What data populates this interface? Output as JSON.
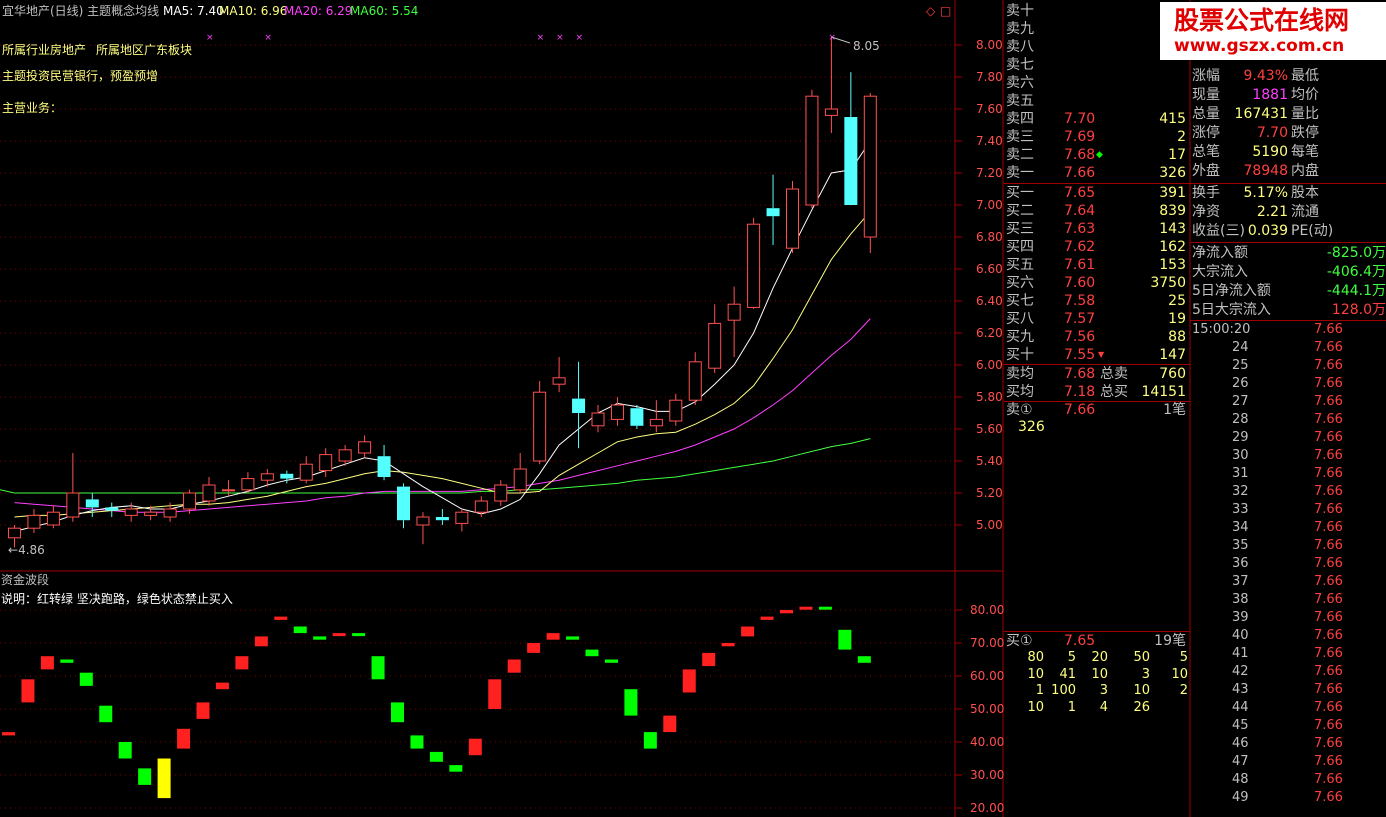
{
  "header": {
    "title": "宜华地产(日线) 主题概念均线",
    "ma5": "MA5: 7.40",
    "ma10": "MA10: 6.96",
    "ma20": "MA20: 6.29",
    "ma60": "MA60: 5.54"
  },
  "info": {
    "line1a": "所属行业房地产",
    "line1b": "所属地区广东板块",
    "line2": "主题投资民营银行，预盈预增",
    "line3": "主营业务："
  },
  "price_axis": [
    "8.00",
    "7.80",
    "7.60",
    "7.40",
    "7.20",
    "7.00",
    "6.80",
    "6.60",
    "6.40",
    "6.20",
    "6.00",
    "5.80",
    "5.60",
    "5.40",
    "5.20",
    "5.00"
  ],
  "price_labels": {
    "high": "8.05",
    "low": "4.86"
  },
  "indicator": {
    "name": "资金波段",
    "desc": "说明：红转绿 坚决跑路，绿色状态禁止买入",
    "axis": [
      "80.00",
      "70.00",
      "60.00",
      "50.00",
      "40.00",
      "30.00",
      "20.00"
    ]
  },
  "chart_data": {
    "type": "candlestick",
    "candles": [
      {
        "o": 4.92,
        "c": 4.98,
        "h": 5.0,
        "l": 4.86
      },
      {
        "o": 4.98,
        "c": 5.06,
        "h": 5.1,
        "l": 4.95
      },
      {
        "o": 5.0,
        "c": 5.08,
        "h": 5.12,
        "l": 4.98
      },
      {
        "o": 5.05,
        "c": 5.2,
        "h": 5.45,
        "l": 5.02
      },
      {
        "o": 5.16,
        "c": 5.11,
        "h": 5.2,
        "l": 5.05
      },
      {
        "o": 5.11,
        "c": 5.09,
        "h": 5.14,
        "l": 5.05
      },
      {
        "o": 5.06,
        "c": 5.1,
        "h": 5.14,
        "l": 5.02
      },
      {
        "o": 5.06,
        "c": 5.08,
        "h": 5.12,
        "l": 5.03
      },
      {
        "o": 5.05,
        "c": 5.1,
        "h": 5.14,
        "l": 5.02
      },
      {
        "o": 5.1,
        "c": 5.2,
        "h": 5.22,
        "l": 5.07
      },
      {
        "o": 5.15,
        "c": 5.25,
        "h": 5.3,
        "l": 5.12
      },
      {
        "o": 5.22,
        "c": 5.22,
        "h": 5.28,
        "l": 5.18
      },
      {
        "o": 5.22,
        "c": 5.29,
        "h": 5.33,
        "l": 5.2
      },
      {
        "o": 5.28,
        "c": 5.32,
        "h": 5.35,
        "l": 5.24
      },
      {
        "o": 5.32,
        "c": 5.29,
        "h": 5.34,
        "l": 5.26
      },
      {
        "o": 5.28,
        "c": 5.38,
        "h": 5.43,
        "l": 5.26
      },
      {
        "o": 5.34,
        "c": 5.44,
        "h": 5.48,
        "l": 5.3
      },
      {
        "o": 5.4,
        "c": 5.47,
        "h": 5.5,
        "l": 5.37
      },
      {
        "o": 5.45,
        "c": 5.52,
        "h": 5.56,
        "l": 5.42
      },
      {
        "o": 5.43,
        "c": 5.3,
        "h": 5.5,
        "l": 5.28
      },
      {
        "o": 5.24,
        "c": 5.03,
        "h": 5.26,
        "l": 4.98
      },
      {
        "o": 5.0,
        "c": 5.05,
        "h": 5.08,
        "l": 4.88
      },
      {
        "o": 5.05,
        "c": 5.03,
        "h": 5.1,
        "l": 5.0
      },
      {
        "o": 5.01,
        "c": 5.08,
        "h": 5.1,
        "l": 4.96
      },
      {
        "o": 5.08,
        "c": 5.15,
        "h": 5.18,
        "l": 5.05
      },
      {
        "o": 5.15,
        "c": 5.25,
        "h": 5.28,
        "l": 5.12
      },
      {
        "o": 5.22,
        "c": 5.35,
        "h": 5.45,
        "l": 5.2
      },
      {
        "o": 5.4,
        "c": 5.83,
        "h": 5.9,
        "l": 5.38
      },
      {
        "o": 5.88,
        "c": 5.92,
        "h": 6.05,
        "l": 5.83
      },
      {
        "o": 5.79,
        "c": 5.7,
        "h": 6.02,
        "l": 5.48
      },
      {
        "o": 5.62,
        "c": 5.7,
        "h": 5.75,
        "l": 5.58
      },
      {
        "o": 5.66,
        "c": 5.75,
        "h": 5.8,
        "l": 5.62
      },
      {
        "o": 5.73,
        "c": 5.62,
        "h": 5.75,
        "l": 5.6
      },
      {
        "o": 5.62,
        "c": 5.66,
        "h": 5.78,
        "l": 5.58
      },
      {
        "o": 5.65,
        "c": 5.78,
        "h": 5.82,
        "l": 5.62
      },
      {
        "o": 5.78,
        "c": 6.02,
        "h": 6.08,
        "l": 5.75
      },
      {
        "o": 5.98,
        "c": 6.26,
        "h": 6.38,
        "l": 5.95
      },
      {
        "o": 6.28,
        "c": 6.38,
        "h": 6.49,
        "l": 6.05
      },
      {
        "o": 6.36,
        "c": 6.88,
        "h": 6.92,
        "l": 6.35
      },
      {
        "o": 6.98,
        "c": 6.93,
        "h": 7.19,
        "l": 6.75
      },
      {
        "o": 6.73,
        "c": 7.1,
        "h": 7.15,
        "l": 6.7
      },
      {
        "o": 7.0,
        "c": 7.68,
        "h": 7.72,
        "l": 6.98
      },
      {
        "o": 7.56,
        "c": 7.6,
        "h": 8.05,
        "l": 7.45
      },
      {
        "o": 7.55,
        "c": 7.0,
        "h": 7.83,
        "l": 7.0
      },
      {
        "o": 6.8,
        "c": 7.68,
        "h": 7.7,
        "l": 6.7
      }
    ],
    "ma5": [
      4.96,
      4.99,
      5.02,
      5.06,
      5.09,
      5.11,
      5.12,
      5.1,
      5.1,
      5.13,
      5.15,
      5.18,
      5.21,
      5.25,
      5.28,
      5.3,
      5.34,
      5.38,
      5.42,
      5.4,
      5.32,
      5.24,
      5.17,
      5.1,
      5.07,
      5.1,
      5.16,
      5.32,
      5.5,
      5.6,
      5.7,
      5.76,
      5.74,
      5.71,
      5.71,
      5.77,
      5.88,
      6.0,
      6.2,
      6.48,
      6.73,
      6.97,
      7.2,
      7.22,
      7.4
    ],
    "ma10": [
      5.05,
      5.06,
      5.06,
      5.07,
      5.08,
      5.09,
      5.1,
      5.11,
      5.12,
      5.13,
      5.13,
      5.14,
      5.16,
      5.18,
      5.21,
      5.24,
      5.26,
      5.29,
      5.32,
      5.34,
      5.33,
      5.31,
      5.29,
      5.26,
      5.23,
      5.2,
      5.2,
      5.21,
      5.31,
      5.38,
      5.45,
      5.52,
      5.55,
      5.57,
      5.58,
      5.63,
      5.69,
      5.76,
      5.87,
      6.04,
      6.22,
      6.44,
      6.66,
      6.82,
      6.96
    ],
    "ma20": [
      5.14,
      5.13,
      5.12,
      5.11,
      5.1,
      5.09,
      5.08,
      5.08,
      5.08,
      5.09,
      5.1,
      5.11,
      5.12,
      5.13,
      5.14,
      5.15,
      5.17,
      5.18,
      5.2,
      5.21,
      5.21,
      5.21,
      5.21,
      5.21,
      5.22,
      5.23,
      5.24,
      5.26,
      5.28,
      5.31,
      5.34,
      5.37,
      5.4,
      5.43,
      5.46,
      5.5,
      5.55,
      5.6,
      5.67,
      5.75,
      5.84,
      5.95,
      6.06,
      6.16,
      6.29
    ],
    "ma60": [
      5.2,
      5.2,
      5.2,
      5.2,
      5.2,
      5.2,
      5.2,
      5.2,
      5.2,
      5.2,
      5.2,
      5.2,
      5.2,
      5.2,
      5.2,
      5.2,
      5.2,
      5.2,
      5.2,
      5.2,
      5.2,
      5.2,
      5.2,
      5.2,
      5.21,
      5.21,
      5.22,
      5.22,
      5.23,
      5.24,
      5.25,
      5.26,
      5.28,
      5.29,
      5.3,
      5.32,
      5.34,
      5.36,
      5.38,
      5.4,
      5.43,
      5.46,
      5.49,
      5.51,
      5.54
    ],
    "wave": [
      {
        "o": 43,
        "c": 42,
        "col": "r"
      },
      {
        "o": 59,
        "c": 52,
        "col": "r"
      },
      {
        "o": 62,
        "c": 66,
        "col": "r"
      },
      {
        "o": 64,
        "c": 65,
        "col": "g"
      },
      {
        "o": 61,
        "c": 57,
        "col": "g"
      },
      {
        "o": 51,
        "c": 46,
        "col": "g"
      },
      {
        "o": 40,
        "c": 35,
        "col": "g"
      },
      {
        "o": 32,
        "c": 27,
        "col": "g"
      },
      {
        "o": 35,
        "c": 23,
        "col": "y"
      },
      {
        "o": 38,
        "c": 44,
        "col": "r"
      },
      {
        "o": 47,
        "c": 52,
        "col": "r"
      },
      {
        "o": 56,
        "c": 58,
        "col": "r"
      },
      {
        "o": 62,
        "c": 66,
        "col": "r"
      },
      {
        "o": 69,
        "c": 72,
        "col": "r"
      },
      {
        "o": 77,
        "c": 78,
        "col": "r"
      },
      {
        "o": 75,
        "c": 73,
        "col": "g"
      },
      {
        "o": 72,
        "c": 71,
        "col": "g"
      },
      {
        "o": 73,
        "c": 73,
        "col": "r"
      },
      {
        "o": 73,
        "c": 73,
        "col": "g"
      },
      {
        "o": 66,
        "c": 59,
        "col": "g"
      },
      {
        "o": 52,
        "c": 46,
        "col": "g"
      },
      {
        "o": 42,
        "c": 38,
        "col": "g"
      },
      {
        "o": 37,
        "c": 34,
        "col": "g"
      },
      {
        "o": 33,
        "c": 31,
        "col": "g"
      },
      {
        "o": 36,
        "c": 41,
        "col": "r"
      },
      {
        "o": 50,
        "c": 59,
        "col": "r"
      },
      {
        "o": 61,
        "c": 65,
        "col": "r"
      },
      {
        "o": 67,
        "c": 70,
        "col": "r"
      },
      {
        "o": 71,
        "c": 73,
        "col": "r"
      },
      {
        "o": 72,
        "c": 71,
        "col": "g"
      },
      {
        "o": 68,
        "c": 66,
        "col": "g"
      },
      {
        "o": 65,
        "c": 64,
        "col": "g"
      },
      {
        "o": 56,
        "c": 48,
        "col": "g"
      },
      {
        "o": 43,
        "c": 38,
        "col": "g"
      },
      {
        "o": 43,
        "c": 48,
        "col": "r"
      },
      {
        "o": 55,
        "c": 62,
        "col": "r"
      },
      {
        "o": 63,
        "c": 67,
        "col": "r"
      },
      {
        "o": 69,
        "c": 70,
        "col": "r"
      },
      {
        "o": 72,
        "c": 75,
        "col": "r"
      },
      {
        "o": 77,
        "c": 78,
        "col": "r"
      },
      {
        "o": 79,
        "c": 80,
        "col": "r"
      },
      {
        "o": 81,
        "c": 81,
        "col": "r"
      },
      {
        "o": 81,
        "c": 81,
        "col": "g"
      },
      {
        "o": 74,
        "c": 68,
        "col": "g"
      },
      {
        "o": 66,
        "c": 64,
        "col": "g"
      }
    ]
  },
  "orderbook": {
    "sell": [
      {
        "label": "卖十",
        "price": "",
        "vol": ""
      },
      {
        "label": "卖九",
        "price": "",
        "vol": ""
      },
      {
        "label": "卖八",
        "price": "",
        "vol": ""
      },
      {
        "label": "卖七",
        "price": "",
        "vol": ""
      },
      {
        "label": "卖六",
        "price": "",
        "vol": ""
      },
      {
        "label": "卖五",
        "price": "",
        "vol": ""
      },
      {
        "label": "卖四",
        "price": "7.70",
        "vol": "415"
      },
      {
        "label": "卖三",
        "price": "7.69",
        "vol": "2"
      },
      {
        "label": "卖二",
        "price": "7.68",
        "vol": "17"
      },
      {
        "label": "卖一",
        "price": "7.66",
        "vol": "326"
      }
    ],
    "buy": [
      {
        "label": "买一",
        "price": "7.65",
        "vol": "391"
      },
      {
        "label": "买二",
        "price": "7.64",
        "vol": "839"
      },
      {
        "label": "买三",
        "price": "7.63",
        "vol": "143"
      },
      {
        "label": "买四",
        "price": "7.62",
        "vol": "162"
      },
      {
        "label": "买五",
        "price": "7.61",
        "vol": "153"
      },
      {
        "label": "买六",
        "price": "7.60",
        "vol": "3750"
      },
      {
        "label": "买七",
        "price": "7.58",
        "vol": "25"
      },
      {
        "label": "买八",
        "price": "7.57",
        "vol": "19"
      },
      {
        "label": "买九",
        "price": "7.56",
        "vol": "88"
      },
      {
        "label": "买十",
        "price": "7.55",
        "vol": "147"
      }
    ],
    "avg_sell_label": "卖均",
    "avg_sell": "7.68",
    "total_sell_label": "总卖",
    "total_sell": "760",
    "avg_buy_label": "买均",
    "avg_buy": "7.18",
    "total_buy_label": "总买",
    "total_buy": "14151",
    "sell1_label": "卖①",
    "sell1_price": "7.66",
    "sell1_count": "1笔",
    "sell1_q": "326",
    "buy1_label": "买①",
    "buy1_price": "7.65",
    "buy1_count": "19笔",
    "buy1_queue": [
      [
        "80",
        "5",
        "20",
        "50",
        "5"
      ],
      [
        "10",
        "41",
        "10",
        "3",
        "10"
      ],
      [
        "1",
        "100",
        "3",
        "10",
        "2"
      ],
      [
        "10",
        "1",
        "4",
        "26",
        ""
      ]
    ]
  },
  "quote": {
    "rows": [
      {
        "l1": "涨幅",
        "v1": "9.43%",
        "l2": "最低"
      },
      {
        "l1": "现量",
        "v1": "1881",
        "l2": "均价"
      },
      {
        "l1": "总量",
        "v1": "167431",
        "l2": "量比"
      },
      {
        "l1": "涨停",
        "v1": "7.70",
        "l2": "跌停"
      },
      {
        "l1": "总笔",
        "v1": "5190",
        "l2": "每笔"
      },
      {
        "l1": "外盘",
        "v1": "78948",
        "l2": "内盘"
      },
      {
        "l1": "换手",
        "v1": "5.17%",
        "l2": "股本"
      },
      {
        "l1": "净资",
        "v1": "2.21",
        "l2": "流通"
      },
      {
        "l1": "收益(三)",
        "v1": "0.039",
        "l2": "PE(动)"
      }
    ],
    "flows": [
      {
        "l": "净流入额",
        "v": "-825.0万"
      },
      {
        "l": "大宗流入",
        "v": "-406.4万"
      },
      {
        "l": "5日净流入额",
        "v": "-444.1万"
      },
      {
        "l": "5日大宗流入",
        "v": "128.0万"
      }
    ]
  },
  "ticks": {
    "first_time": "15:00:20",
    "times": [
      "24",
      "25",
      "26",
      "27",
      "28",
      "29",
      "30",
      "31",
      "32",
      "33",
      "34",
      "35",
      "36",
      "37",
      "38",
      "39",
      "40",
      "41",
      "42",
      "43",
      "44",
      "45",
      "46",
      "47",
      "48",
      "49"
    ],
    "price": "7.66"
  },
  "watermark": {
    "cn": "股票公式在线网",
    "url": "www.gszx.com.cn"
  },
  "colors": {
    "up": "#ff5050",
    "down": "#54ffff",
    "ma5": "#ffffff",
    "ma10": "#ffff80",
    "ma20": "#ff40ff",
    "ma60": "#40ff40",
    "grid": "#800000",
    "yellow": "#ffff00"
  }
}
